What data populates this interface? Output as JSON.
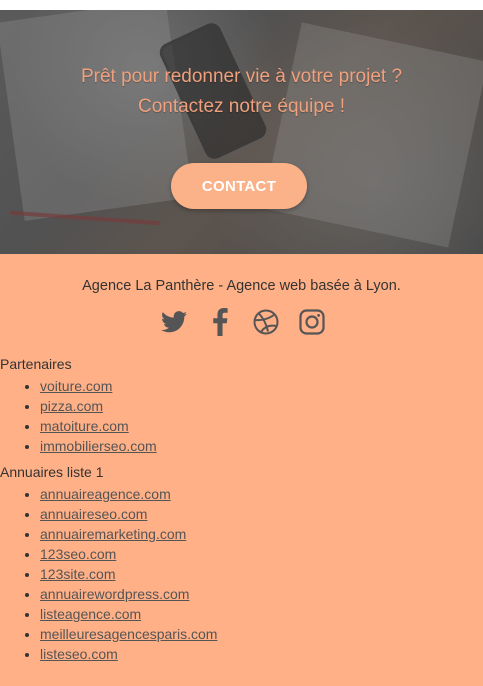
{
  "hero": {
    "line1": "Prêt pour redonner vie à votre projet ?",
    "line2": "Contactez notre équipe !",
    "cta_label": "CONTACT",
    "text_color": "#f0a07c",
    "button_color": "#fcb289"
  },
  "footer": {
    "background": "#ffb086",
    "tagline": "Agence La Panthère - Agence web basée à Lyon.",
    "socials": [
      "twitter-icon",
      "facebook-icon",
      "dribbble-icon",
      "instagram-icon"
    ],
    "partners_title": "Partenaires",
    "partners": [
      "voiture.com",
      "pizza.com",
      "matoiture.com",
      "immobilierseo.com"
    ],
    "directories_title": "Annuaires liste 1",
    "directories": [
      "annuaireagence.com",
      "annuaireseo.com",
      "annuairemarketing.com",
      "123seo.com",
      "123site.com",
      "annuairewordpress.com",
      "listeagence.com",
      "meilleuresagencesparis.com",
      "listeseo.com"
    ]
  }
}
